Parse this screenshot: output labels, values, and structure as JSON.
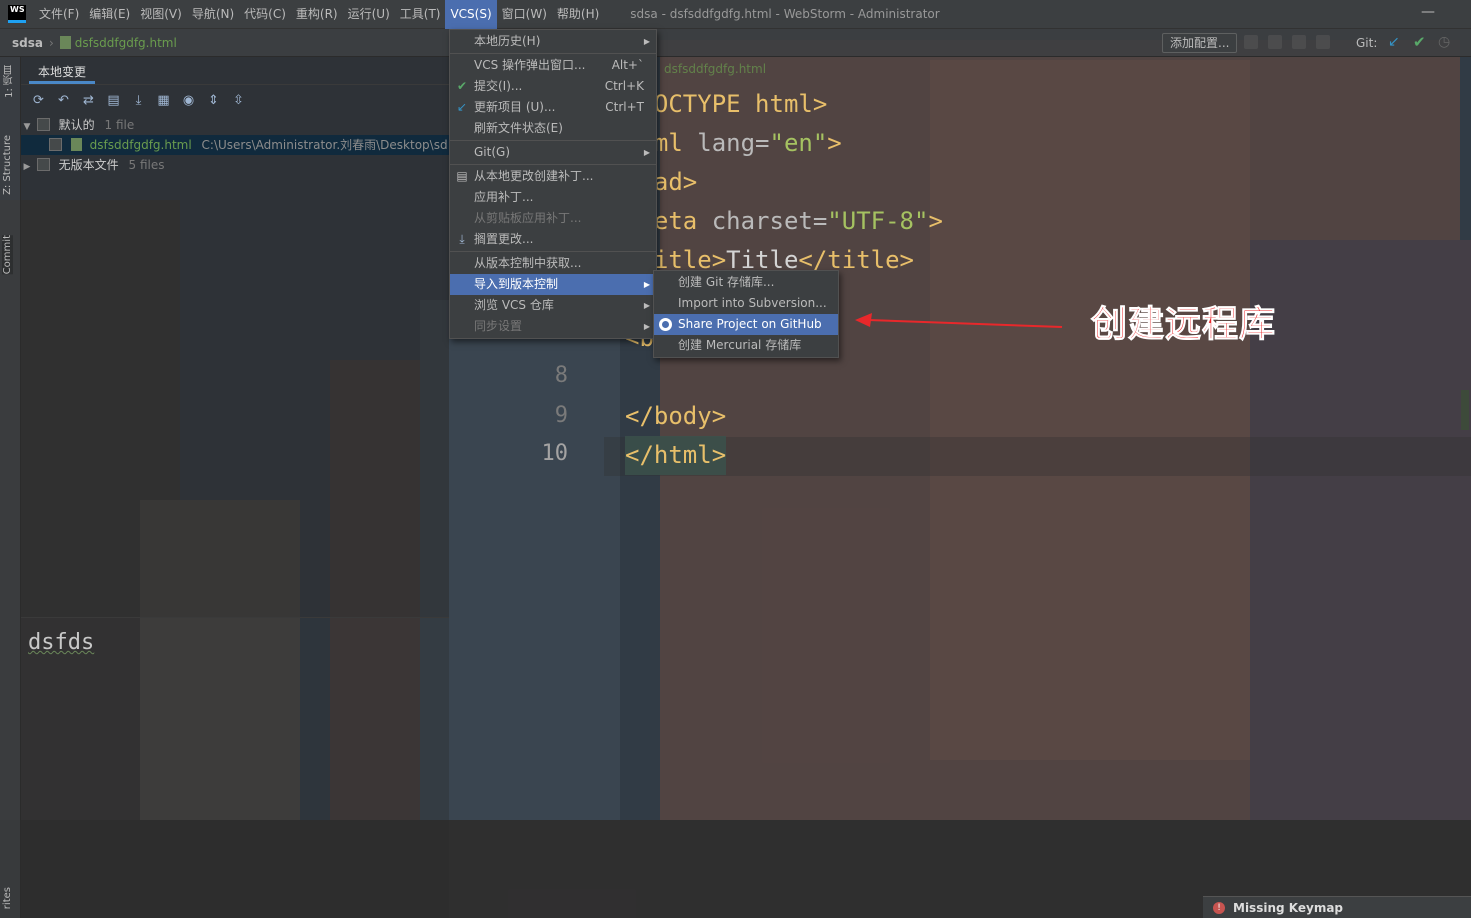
{
  "menubar": {
    "logo": "WS",
    "items": [
      {
        "label": "文件(F)"
      },
      {
        "label": "编辑(E)"
      },
      {
        "label": "视图(V)"
      },
      {
        "label": "导航(N)"
      },
      {
        "label": "代码(C)"
      },
      {
        "label": "重构(R)"
      },
      {
        "label": "运行(U)"
      },
      {
        "label": "工具(T)"
      },
      {
        "label": "VCS(S)"
      },
      {
        "label": "窗口(W)"
      },
      {
        "label": "帮助(H)"
      }
    ],
    "title": "sdsa - dsfsddfgdfg.html - WebStorm - Administrator",
    "minimize": "—"
  },
  "navbar": {
    "project": "sdsa",
    "file": "dsfsddfgdfg.html",
    "add_config": "添加配置...",
    "git_label": "Git:"
  },
  "left_strip": {
    "tabs": [
      "1: 项目",
      "Z: Structure",
      "Commit",
      "rites"
    ]
  },
  "changes": {
    "tab": "本地变更",
    "groups": [
      {
        "label": "默认的",
        "count": "1 file"
      },
      {
        "label": "无版本文件",
        "count": "5 files"
      }
    ],
    "file": {
      "name": "dsfsddfgdfg.html",
      "path": "C:\\Users\\Administrator.刘春雨\\Desktop\\sd"
    },
    "commit_message": "dsfds"
  },
  "editor": {
    "tab": "dsfsddfgdfg.html",
    "line_numbers": [
      "8",
      "9",
      "10"
    ]
  },
  "vcs_menu": {
    "items": [
      {
        "label": "本地历史(H)"
      },
      {
        "label": "VCS 操作弹出窗口...",
        "shortcut": "Alt+`"
      },
      {
        "label": "提交(I)...",
        "shortcut": "Ctrl+K"
      },
      {
        "label": "更新项目 (U)...",
        "shortcut": "Ctrl+T"
      },
      {
        "label": "刷新文件状态(E)"
      },
      {
        "label": "Git(G)"
      },
      {
        "label": "从本地更改创建补丁..."
      },
      {
        "label": "应用补丁..."
      },
      {
        "label": "从剪贴板应用补丁..."
      },
      {
        "label": "搁置更改..."
      },
      {
        "label": "从版本控制中获取..."
      },
      {
        "label": "导入到版本控制"
      },
      {
        "label": "浏览 VCS 仓库"
      },
      {
        "label": "同步设置"
      }
    ]
  },
  "sub_menu": {
    "items": [
      {
        "label": "创建 Git 存储库..."
      },
      {
        "label": "Import into Subversion..."
      },
      {
        "label": "Share Project on GitHub"
      },
      {
        "label": "创建 Mercurial 存储库"
      }
    ]
  },
  "annotation": {
    "text": "创建远程库",
    "color": "#e8282b"
  },
  "notification": {
    "text": "Missing Keymap"
  },
  "colors": {
    "accent": "#4b6eaf",
    "tag": "#e8bf6a",
    "string": "#a5c261",
    "file_green": "#6a9c4e"
  }
}
